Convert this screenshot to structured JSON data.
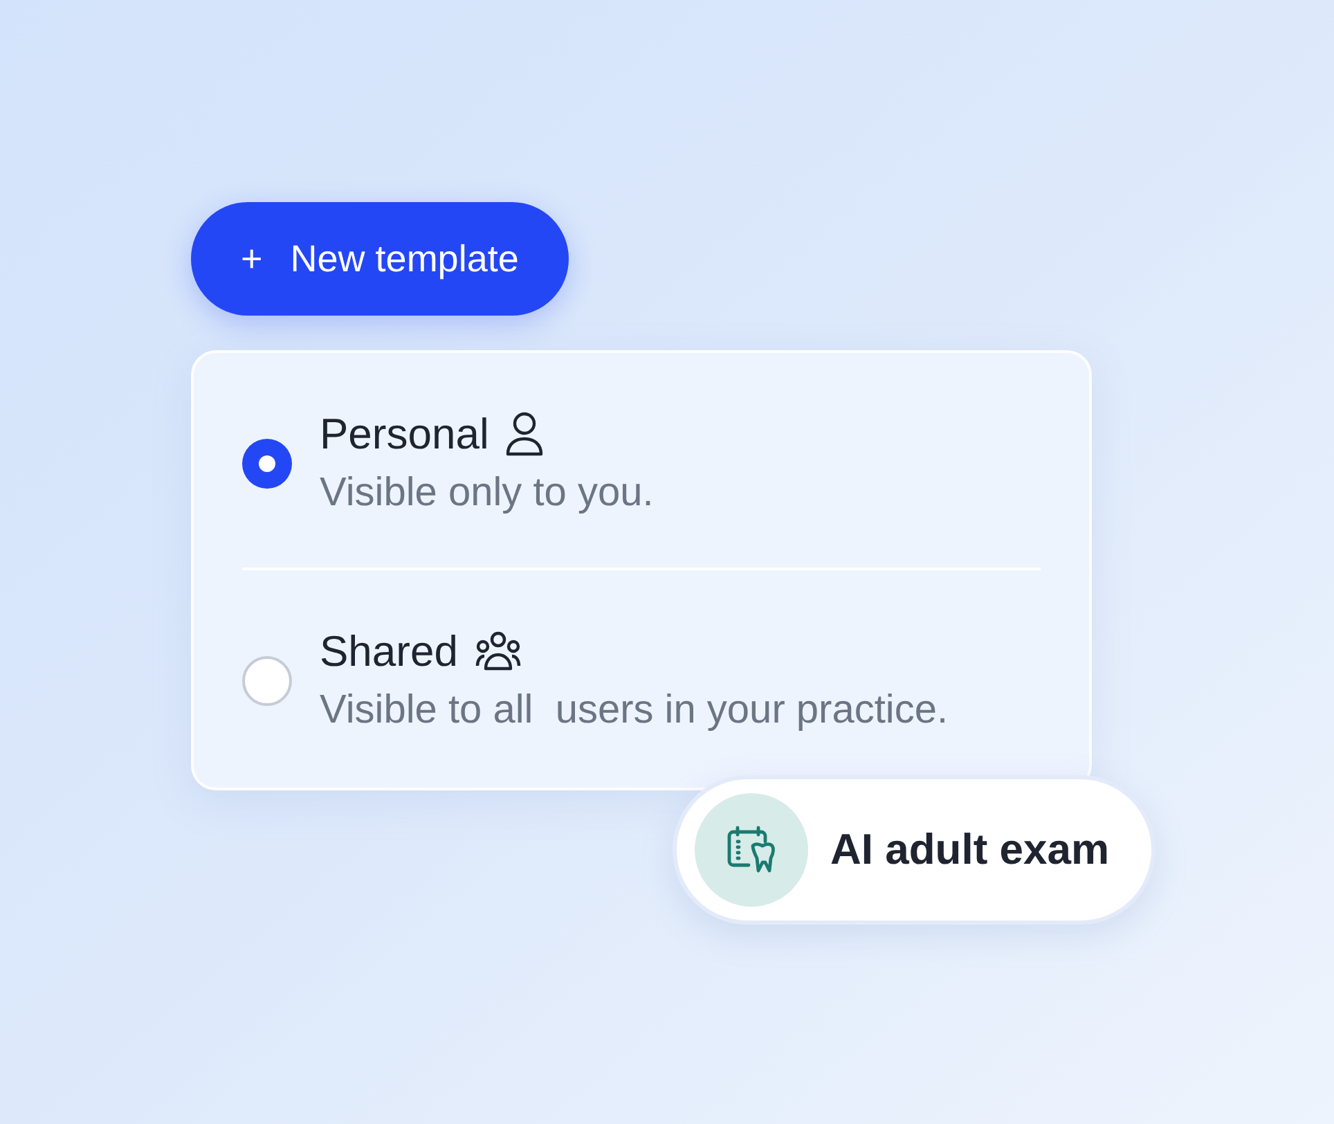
{
  "new_button": {
    "icon": "+",
    "label": "New template"
  },
  "options": [
    {
      "kind": "personal",
      "title": "Personal",
      "description": "Visible only to you.",
      "selected": true
    },
    {
      "kind": "shared",
      "title": "Shared",
      "description": "Visible to all  users in your practice.",
      "selected": false
    }
  ],
  "chip": {
    "label": "AI adult exam"
  }
}
